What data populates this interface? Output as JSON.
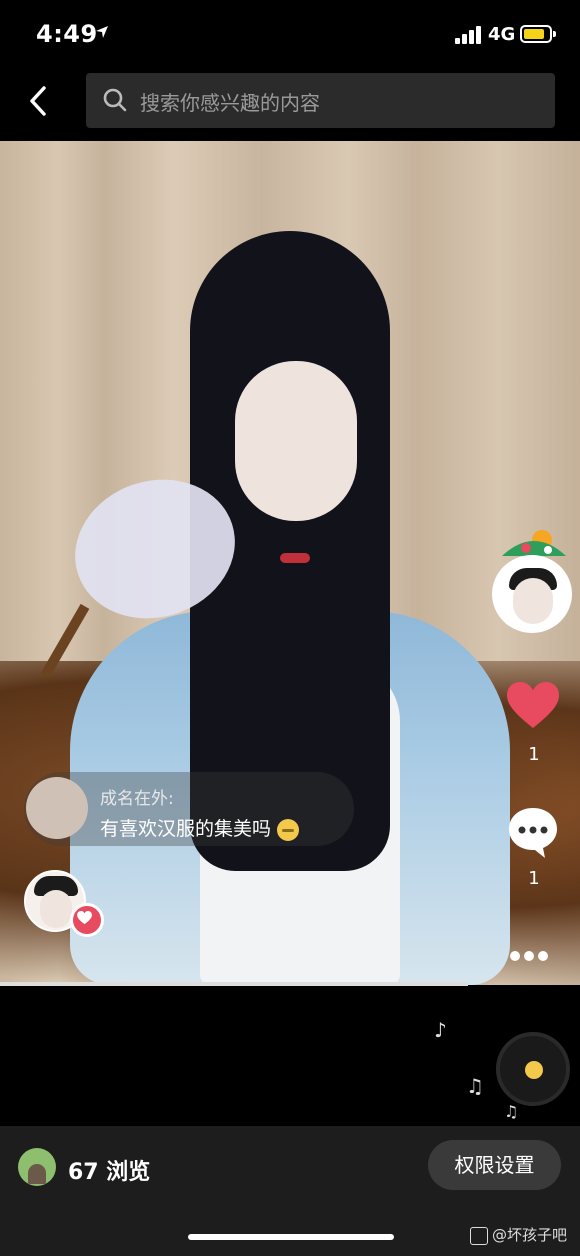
{
  "status_bar": {
    "time": "4:49",
    "network": "4G",
    "location_icon": "location-arrow-icon",
    "battery_color": "#f5d21a",
    "battery_level": 0.7
  },
  "header": {
    "back_icon": "chevron-left-icon",
    "search_placeholder": "搜索你感兴趣的内容"
  },
  "video": {
    "right_rail": {
      "like_count": "1",
      "comment_count": "1",
      "like_color": "#e84a5f"
    },
    "comment": {
      "username": "成名在外:",
      "text": "有喜欢汉服的集美吗"
    }
  },
  "bottom_bar": {
    "views_label": "67 浏览",
    "permissions_button": "权限设置",
    "watermark": "@坏孩子吧"
  }
}
